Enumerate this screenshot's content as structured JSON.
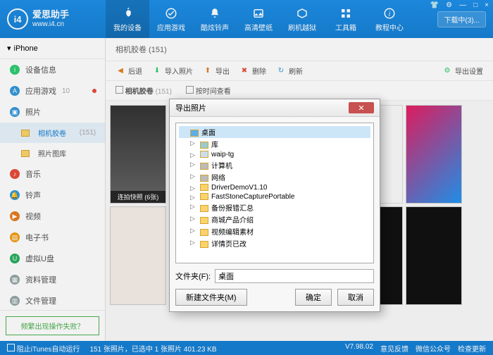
{
  "app": {
    "title": "爱思助手",
    "url": "www.i4.cn",
    "logo_text": "i4"
  },
  "win_controls": {
    "settings": "⚙",
    "shirt": "👕",
    "min": "—",
    "max": "□",
    "close": "×"
  },
  "nav": [
    {
      "label": "我的设备",
      "icon": "apple"
    },
    {
      "label": "应用游戏",
      "icon": "apps"
    },
    {
      "label": "酷炫铃声",
      "icon": "bell"
    },
    {
      "label": "高清壁纸",
      "icon": "image"
    },
    {
      "label": "刷机越狱",
      "icon": "box"
    },
    {
      "label": "工具箱",
      "icon": "tools"
    },
    {
      "label": "教程中心",
      "icon": "info"
    }
  ],
  "download_btn": "下载中(3)...",
  "device": {
    "name": "iPhone",
    "expand": "▾"
  },
  "sidebar": {
    "items": [
      {
        "label": "设备信息",
        "color": "#2ecc71"
      },
      {
        "label": "应用游戏",
        "color": "#3498db",
        "badge": "10"
      },
      {
        "label": "照片",
        "color": "#3498db",
        "active": true
      },
      {
        "label": "音乐",
        "color": "#e74c3c"
      },
      {
        "label": "铃声",
        "color": "#3498db"
      },
      {
        "label": "视频",
        "color": "#e67e22"
      },
      {
        "label": "电子书",
        "color": "#f39c12"
      },
      {
        "label": "虚拟U盘",
        "color": "#27ae60"
      },
      {
        "label": "资料管理",
        "color": "#95a5a6"
      },
      {
        "label": "文件管理",
        "color": "#95a5a6"
      }
    ],
    "photo_sub": [
      {
        "label": "相机胶卷",
        "count": "(151)",
        "active": true
      },
      {
        "label": "照片图库",
        "count": ""
      }
    ],
    "faq": "频繁出现操作失败？"
  },
  "breadcrumb": "相机胶卷 (151)",
  "toolbar": {
    "back": "后退",
    "import": "导入照片",
    "export": "导出",
    "delete": "删除",
    "refresh": "刷新",
    "export_settings": "导出设置"
  },
  "filter": {
    "camera_roll": "相机胶卷",
    "camera_count": "(151)",
    "by_time": "按时间查看"
  },
  "thumbs": {
    "burst": "连拍快照 (6张)"
  },
  "statusbar": {
    "block_itunes": "阻止iTunes自动运行",
    "info": "151 张照片，已选中 1 张照片 401.23 KB",
    "version": "V7.98.02",
    "feedback": "意见反馈",
    "wechat": "微信公众号",
    "update": "检查更新"
  },
  "dialog": {
    "title": "导出照片",
    "tree": {
      "root": "桌面",
      "items": [
        {
          "label": "库",
          "icon": "lib"
        },
        {
          "label": "waip-tg",
          "icon": "user"
        },
        {
          "label": "计算机",
          "icon": "pc"
        },
        {
          "label": "网络",
          "icon": "net"
        },
        {
          "label": "DriverDemoV1.10",
          "icon": "folder"
        },
        {
          "label": "FastStoneCapturePortable",
          "icon": "folder"
        },
        {
          "label": "备份报错汇总",
          "icon": "folder"
        },
        {
          "label": "商城产品介绍",
          "icon": "folder"
        },
        {
          "label": "视频编辑素材",
          "icon": "folder"
        },
        {
          "label": "详情页已改",
          "icon": "folder"
        }
      ]
    },
    "folder_label": "文件夹(F):",
    "folder_value": "桌面",
    "new_folder": "新建文件夹(M)",
    "ok": "确定",
    "cancel": "取消"
  }
}
